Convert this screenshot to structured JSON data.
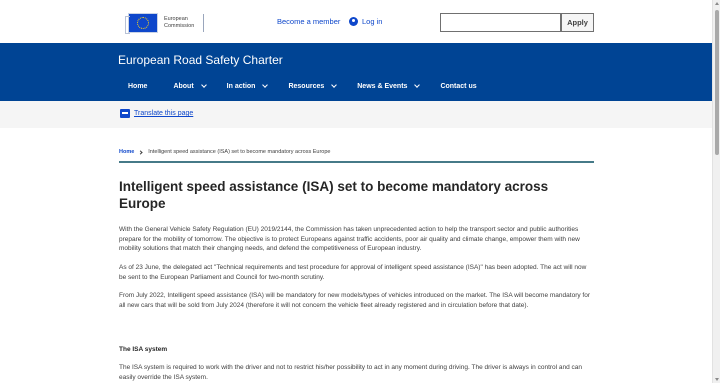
{
  "utility": {
    "logo_line1": "European",
    "logo_line2": "Commission",
    "become_member": "Become a member",
    "login": "Log in",
    "search_placeholder": "",
    "apply_label": "Apply"
  },
  "header": {
    "site_title": "European Road Safety Charter",
    "nav": [
      {
        "label": "Home",
        "has_dropdown": false
      },
      {
        "label": "About",
        "has_dropdown": true
      },
      {
        "label": "In action",
        "has_dropdown": true
      },
      {
        "label": "Resources",
        "has_dropdown": true
      },
      {
        "label": "News & Events",
        "has_dropdown": true
      },
      {
        "label": "Contact us",
        "has_dropdown": false
      }
    ]
  },
  "translate": {
    "label": "Translate this page"
  },
  "breadcrumb": {
    "home": "Home",
    "current": "Intelligent speed assistance (ISA) set to become mandatory across Europe"
  },
  "article": {
    "title": "Intelligent speed assistance (ISA) set to become mandatory across Europe",
    "paragraphs": [
      "With the General Vehicle Safety Regulation (EU) 2019/2144, the Commission has taken unprecedented action to help the transport sector and public authorities prepare for the mobility of tomorrow. The objective is to protect Europeans against traffic accidents, poor air quality and climate change, empower them with new mobility solutions that match their changing needs, and defend the competitiveness of European industry.",
      "As of 23 June, the delegated act \"Technical requirements and test procedure for approval of intelligent speed assistance (ISA)\" has been adopted. The act will now be sent to the European Parliament and Council for two-month scrutiny.",
      "From July 2022, Intelligent speed assistance (ISA) will be mandatory for new models/types of vehicles introduced on the market. The ISA will become mandatory for all new cars that will be sold from July 2024 (therefore it will not concern the vehicle fleet already registered and in circulation before that date)."
    ],
    "subheading": "The ISA system",
    "paragraph4": "The ISA system is required to work with the driver and not to restrict his/her possibility to act in any moment during driving. The driver is always in control and can easily override the ISA system."
  }
}
